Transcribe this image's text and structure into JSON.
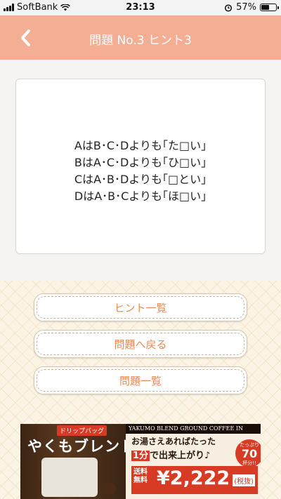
{
  "status_bar": {
    "carrier": "SoftBank",
    "time": "23:13",
    "battery_percent": "57%",
    "battery_level": 0.57
  },
  "header": {
    "title": "問題 No.3 ヒント3"
  },
  "hint": {
    "lines": [
      "AはB･C･Dよりも｢た□い｣",
      "BはA･C･Dよりも｢ひ□い｣",
      "CはA･B･Dよりも｢□とい｣",
      "DはA･B･Cよりも｢ほ□い｣"
    ]
  },
  "buttons": {
    "hint_list": "ヒント一覧",
    "back_to_question": "問題へ戻る",
    "question_list": "問題一覧"
  },
  "ad": {
    "tag": "ドリップバッグ",
    "brand": "やくもブレンド",
    "header_text": "YAKUMO BLEND GROUND COFFEE IN",
    "copy_line1": "お湯さえあればたった",
    "copy_highlight": "1分",
    "copy_line2_rest": "で出来上がり♪",
    "badge_top": "たっぷり",
    "badge_number": "70",
    "badge_bottom": "杯分!!",
    "shipping": "送料無料",
    "price": "¥2,222",
    "tax": "(税抜)"
  },
  "colors": {
    "header_bg": "#f3ae93",
    "button_text": "#ee8a55",
    "pattern_bg": "#fbf3e3"
  }
}
